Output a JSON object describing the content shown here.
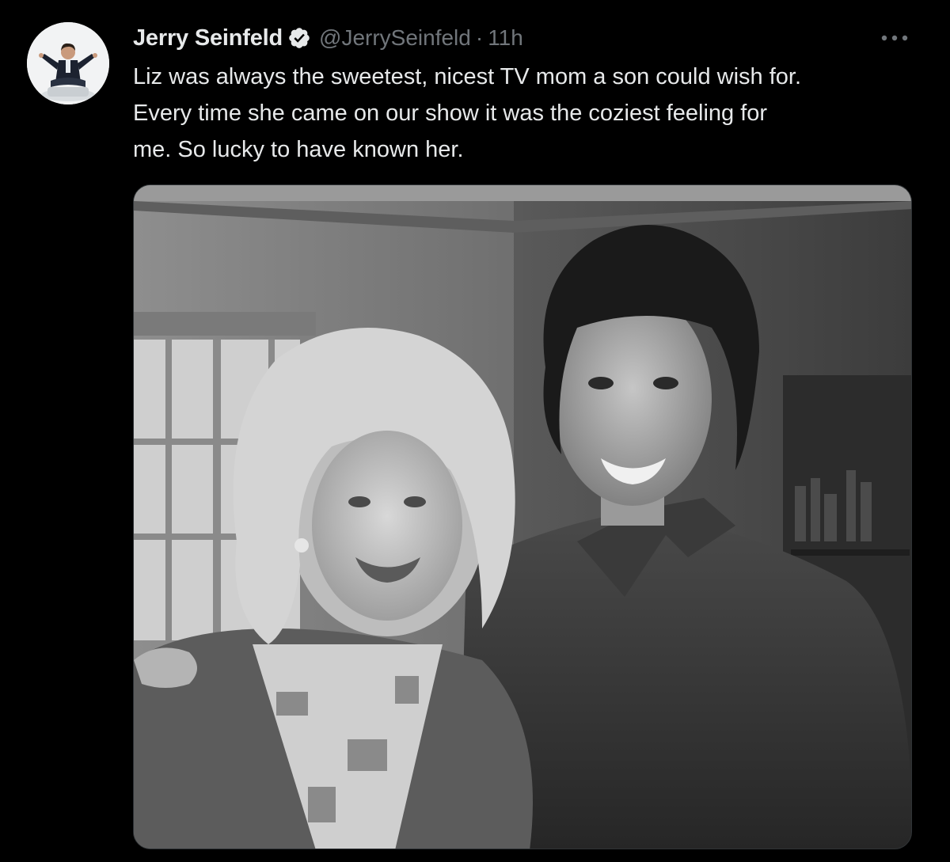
{
  "tweet": {
    "author": {
      "display_name": "Jerry Seinfeld",
      "verified": true,
      "handle": "@JerrySeinfeld",
      "avatar_icon": "avatar-photo"
    },
    "separator": "·",
    "timestamp": "11h",
    "more_icon": "more-options-icon",
    "text_lines": [
      "Liz was always the sweetest, nicest TV mom a son could wish for.",
      "Every time she came on our show it was the coziest feeling for",
      "me. So lucky to have known her."
    ],
    "media": {
      "type": "photo",
      "style": "black-and-white"
    }
  },
  "colors": {
    "background": "#000000",
    "primary_text": "#e7e9ea",
    "secondary_text": "#71767b",
    "verified_badge": "#e7e9ea"
  }
}
